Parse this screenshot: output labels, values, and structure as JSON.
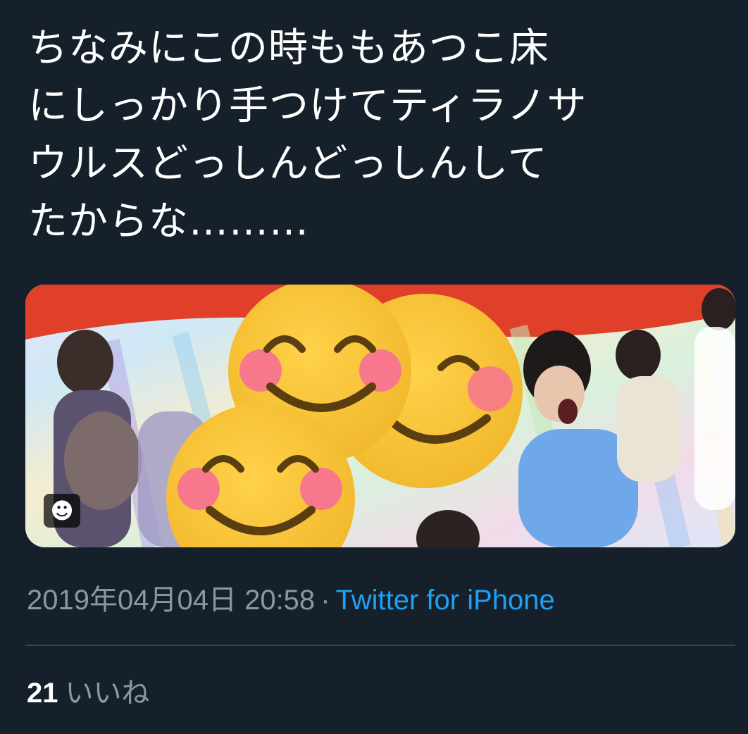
{
  "tweet": {
    "text": "ちなみにこの時ももあつこ床\nにしっかり手つけてティラノサ\nウルスどっしんどっしんして\nたからな………",
    "media_badge_icon": "smiley-face-icon",
    "timestamp": "2019年04月04日 20:58",
    "separator": "·",
    "source": "Twitter for iPhone",
    "likes": {
      "count": "21",
      "label": "いいね"
    }
  },
  "colors": {
    "background": "#15202b",
    "text": "#ffffff",
    "muted": "#8899a6",
    "link": "#1da1f2",
    "divider": "#38444d",
    "emoji_face": "#f7c33c",
    "emoji_cheek": "#f7788c"
  }
}
